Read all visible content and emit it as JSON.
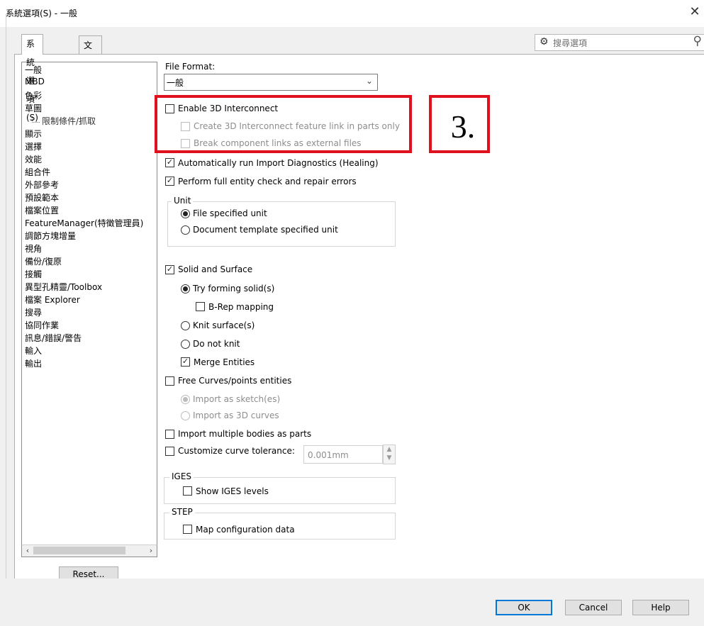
{
  "window": {
    "title": "系統選項(S) - 一般"
  },
  "tabs": [
    {
      "label": "系統選項(S)",
      "active": true
    },
    {
      "label": "文件屬性(D)",
      "active": false
    }
  ],
  "search": {
    "label": "搜尋選項"
  },
  "sidebar": {
    "items": [
      {
        "label": "一般",
        "sub": false
      },
      {
        "label": "MBD",
        "sub": false
      },
      {
        "label": "色彩",
        "sub": false
      },
      {
        "label": "草圖",
        "sub": false
      },
      {
        "label": "限制條件/抓取",
        "sub": true
      },
      {
        "label": "顯示",
        "sub": false
      },
      {
        "label": "選擇",
        "sub": false
      },
      {
        "label": "效能",
        "sub": false
      },
      {
        "label": "組合件",
        "sub": false
      },
      {
        "label": "外部參考",
        "sub": false
      },
      {
        "label": "預設範本",
        "sub": false
      },
      {
        "label": "檔案位置",
        "sub": false
      },
      {
        "label": "FeatureManager(特徵管理員)",
        "sub": false
      },
      {
        "label": "調節方塊增量",
        "sub": false
      },
      {
        "label": "視角",
        "sub": false
      },
      {
        "label": "備份/復原",
        "sub": false
      },
      {
        "label": "接觸",
        "sub": false
      },
      {
        "label": "異型孔精靈/Toolbox",
        "sub": false
      },
      {
        "label": "檔案 Explorer",
        "sub": false
      },
      {
        "label": "搜尋",
        "sub": false
      },
      {
        "label": "協同作業",
        "sub": false
      },
      {
        "label": "訊息/錯誤/警告",
        "sub": false
      },
      {
        "label": "輸入",
        "sub": false
      },
      {
        "label": "輸出",
        "sub": false
      }
    ],
    "reset_label": "Reset..."
  },
  "main": {
    "file_format_label": "File Format:",
    "file_format_value": "一般",
    "enable_3d_interconnect": "Enable 3D Interconnect",
    "create_3d_link": "Create 3D Interconnect feature link in parts only",
    "break_links": "Break component links as external files",
    "run_import_diag": "Automatically run Import Diagnostics (Healing)",
    "full_entity_check": "Perform full entity check and repair errors",
    "unit_group": "Unit",
    "unit_file_specified": "File specified unit",
    "unit_document_template": "Document template specified unit",
    "solid_surface": "Solid and Surface",
    "try_forming_solid": "Try forming solid(s)",
    "brep_mapping": "B-Rep mapping",
    "knit_surfaces": "Knit surface(s)",
    "do_not_knit": "Do not knit",
    "merge_entities": "Merge Entities",
    "free_curves": "Free Curves/points entities",
    "import_as_sketch": "Import as sketch(es)",
    "import_as_3d_curves": "Import as 3D curves",
    "import_multiple_bodies": "Import multiple bodies as parts",
    "customize_curve_tolerance": "Customize curve tolerance:",
    "curve_tolerance_value": "0.001mm",
    "iges_group": "IGES",
    "show_iges_levels": "Show IGES levels",
    "step_group": "STEP",
    "map_configuration_data": "Map configuration data"
  },
  "annotation": {
    "step_number": "3.",
    "highlight_color": "#e0111f"
  },
  "footer": {
    "ok": "OK",
    "cancel": "Cancel",
    "help": "Help"
  },
  "icons": {
    "search": "gear-search-icon",
    "magnifier": "magnifier-icon",
    "close": "close-icon"
  }
}
